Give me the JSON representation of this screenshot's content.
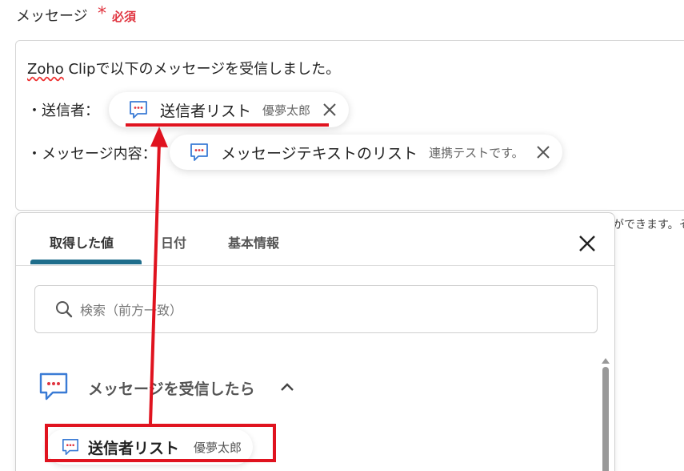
{
  "field": {
    "label": "メッセージ",
    "required_star": "*",
    "required_text": "必須"
  },
  "message": {
    "line1_zoho": "Zoho",
    "line1_rest": " Clipで以下のメッセージを受信しました。",
    "line2_prefix": "・送信者：",
    "line3_prefix": "・メッセージ内容："
  },
  "chips": [
    {
      "label": "送信者リスト",
      "sample": "優夢太郎"
    },
    {
      "label": "メッセージテキストのリスト",
      "sample": "連携テストです。"
    }
  ],
  "hint": "ができます。そ",
  "panel": {
    "tabs": [
      "取得した値",
      "日付",
      "基本情報"
    ],
    "active_tab": 0,
    "search_placeholder": "検索（前方一致）",
    "group_label": "メッセージを受信したら",
    "item": {
      "label": "送信者リスト",
      "sample": "優夢太郎"
    }
  },
  "colors": {
    "accent": "#1f6e8c",
    "highlight_red": "#e0131f",
    "required_red": "#e0343f",
    "icon_blue": "#3a7bd5",
    "icon_dots": "#e0343f"
  },
  "icons": {
    "chip_icon": "chat-bubble-icon",
    "close": "close-icon",
    "search": "search-icon",
    "chevron": "chevron-up-icon"
  }
}
